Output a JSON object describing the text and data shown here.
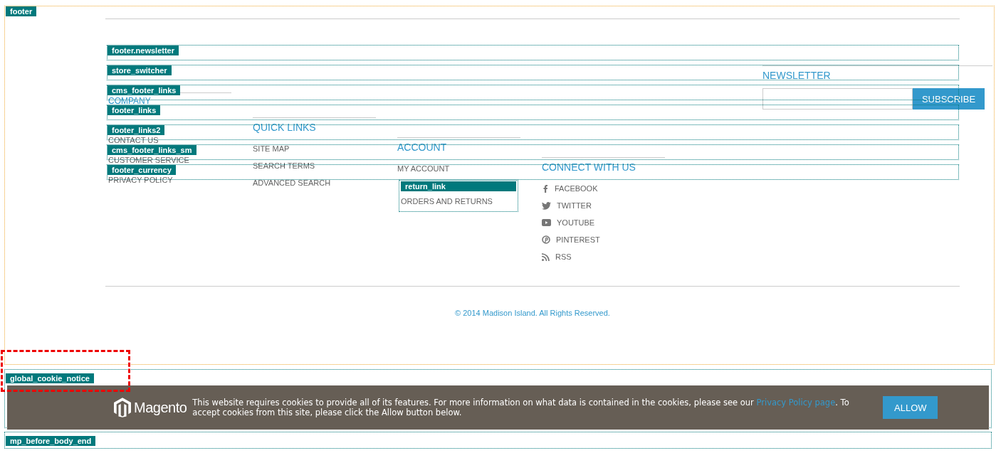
{
  "footer": {
    "hint": "footer",
    "layout_hints": [
      "footer.newsletter",
      "store_switcher",
      "cms_footer_links",
      "footer_links",
      "footer_links2",
      "cms_footer_links_sm",
      "footer_currency"
    ],
    "columns": [
      {
        "kind": "plain",
        "title": "COMPANY",
        "links": [
          {
            "label": "CONTACT US"
          },
          {
            "label": "CUSTOMER SERVICE"
          },
          {
            "label": "PRIVACY POLICY"
          }
        ]
      },
      {
        "kind": "plain",
        "title": "QUICK LINKS",
        "links": [
          {
            "label": "SITE MAP"
          },
          {
            "label": "SEARCH TERMS"
          },
          {
            "label": "ADVANCED SEARCH"
          }
        ]
      },
      {
        "kind": "account",
        "title": "ACCOUNT",
        "links": [
          {
            "label": "MY ACCOUNT"
          }
        ],
        "return_hint": "return_link",
        "return_link": "ORDERS AND RETURNS"
      },
      {
        "kind": "social",
        "title": "CONNECT WITH US",
        "links": [
          {
            "label": "FACEBOOK"
          },
          {
            "label": "TWITTER"
          },
          {
            "label": "YOUTUBE"
          },
          {
            "label": "PINTEREST"
          },
          {
            "label": "RSS"
          }
        ]
      }
    ],
    "newsletter": {
      "title": "NEWSLETTER",
      "button": "SUBSCRIBE"
    },
    "copyright": "© 2014 Madison Island. All Rights Reserved."
  },
  "cookie_notice": {
    "hint": "global_cookie_notice",
    "logo_text": "Magento",
    "text_before": "This website requires cookies to provide all of its features. For more information on what data is contained in the cookies, please see our ",
    "link": "Privacy Policy page",
    "text_after": ". To accept cookies from this site, please click the Allow button below.",
    "button": "ALLOW"
  },
  "body_end": {
    "hint": "mp_before_body_end"
  }
}
